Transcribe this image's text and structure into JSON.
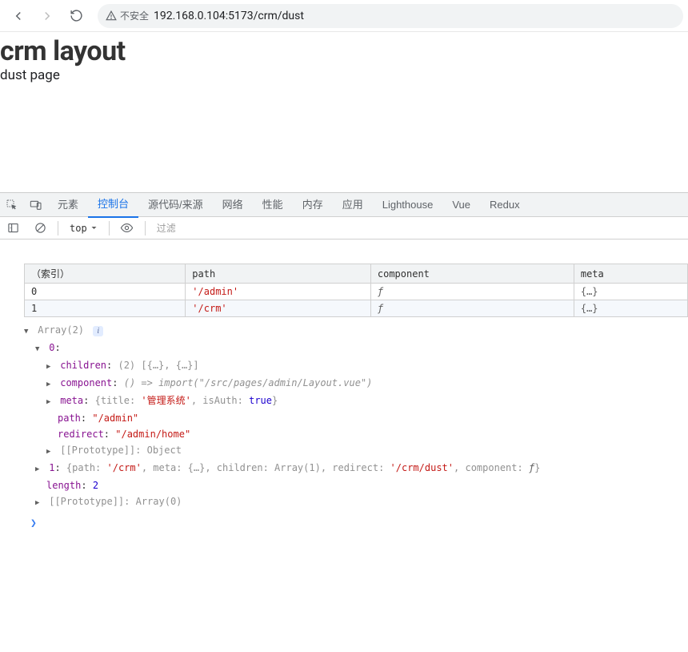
{
  "browser": {
    "security_label": "不安全",
    "url": "192.168.0.104:5173/crm/dust"
  },
  "page": {
    "heading": "crm layout",
    "sub": "dust page"
  },
  "devtools": {
    "tabs": [
      "元素",
      "控制台",
      "源代码/来源",
      "网络",
      "性能",
      "内存",
      "应用",
      "Lighthouse",
      "Vue",
      "Redux"
    ],
    "active_tab_index": 1,
    "context": "top",
    "filter_placeholder": "过滤"
  },
  "table": {
    "headers": [
      "（索引）",
      "path",
      "component",
      "meta"
    ],
    "rows": [
      {
        "index": "0",
        "path": "'/admin'",
        "component": "ƒ",
        "meta": "{…}"
      },
      {
        "index": "1",
        "path": "'/crm'",
        "component": "ƒ",
        "meta": "{…}"
      }
    ]
  },
  "tree": {
    "root_label": "Array(2)",
    "nodes": {
      "idx0": "0",
      "children_lbl": "children",
      "children_val": "(2) [{…}, {…}]",
      "component_lbl": "component",
      "component_val": "() => import(\"/src/pages/admin/Layout.vue\")",
      "meta_lbl": "meta",
      "meta_pre": "{title: ",
      "meta_title": "'管理系统'",
      "meta_mid": ", isAuth: ",
      "meta_auth": "true",
      "meta_post": "}",
      "path_lbl": "path",
      "path_val": "\"/admin\"",
      "redirect_lbl": "redirect",
      "redirect_val": "\"/admin/home\"",
      "proto0_lbl": "[[Prototype]]",
      "proto0_val": "Object",
      "idx1": "1",
      "idx1_pre": "{path: ",
      "idx1_path": "'/crm'",
      "idx1_mid1": ", meta: {…}, children: Array(1), redirect: ",
      "idx1_redirect": "'/crm/dust'",
      "idx1_mid2": ", component: ",
      "idx1_comp": "ƒ",
      "idx1_post": "}",
      "length_lbl": "length",
      "length_val": "2",
      "proto1_lbl": "[[Prototype]]",
      "proto1_val": "Array(0)"
    }
  },
  "prompt": "❯"
}
